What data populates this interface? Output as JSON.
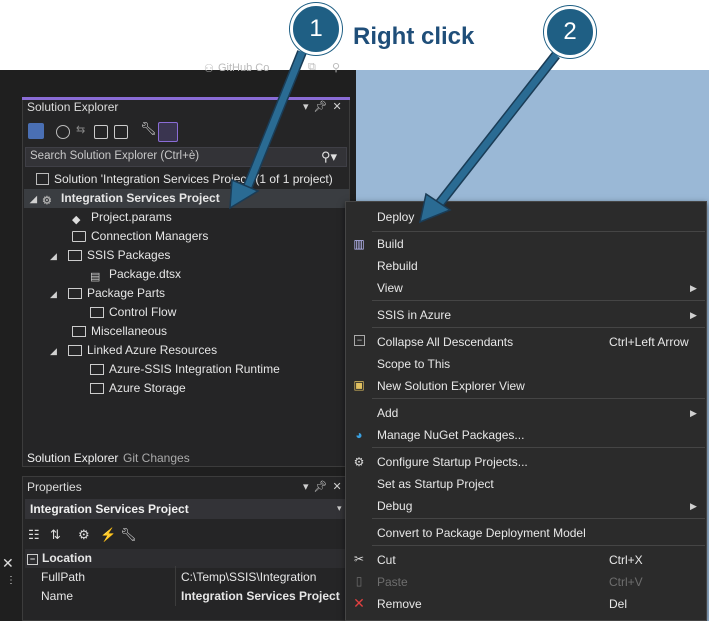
{
  "annotations": {
    "badge1": "1",
    "badge2": "2",
    "right_click_label": "Right click"
  },
  "topbar": {
    "github_label": "GitHub Co"
  },
  "solution_explorer": {
    "title": "Solution Explorer",
    "search_placeholder": "Search Solution Explorer (Ctrl+è)",
    "solution_label": "Solution 'Integration Services Project' (1 of 1 project)",
    "project_label": "Integration Services Project",
    "items": [
      {
        "label": "Project.params",
        "icon": "params-icon"
      },
      {
        "label": "Connection Managers",
        "icon": "folder-icon"
      },
      {
        "label": "SSIS Packages",
        "icon": "folder-icon"
      },
      {
        "label": "Package.dtsx",
        "icon": "package-icon"
      },
      {
        "label": "Package Parts",
        "icon": "folder-icon"
      },
      {
        "label": "Control Flow",
        "icon": "folder-icon"
      },
      {
        "label": "Miscellaneous",
        "icon": "folder-icon"
      },
      {
        "label": "Linked Azure Resources",
        "icon": "folder-icon"
      },
      {
        "label": "Azure-SSIS Integration Runtime",
        "icon": "folder-icon"
      },
      {
        "label": "Azure Storage",
        "icon": "folder-icon"
      }
    ],
    "tabs": [
      "Solution Explorer",
      "Git Changes"
    ]
  },
  "properties": {
    "title": "Properties",
    "object": "Integration Services Project",
    "category": "Location",
    "rows": [
      {
        "name": "FullPath",
        "value": "C:\\Temp\\SSIS\\Integration Service"
      },
      {
        "name": "Name",
        "value": "Integration Services Project"
      }
    ]
  },
  "context_menu": {
    "items": [
      {
        "label": "Deploy",
        "shortcut": ""
      },
      {
        "label": "Build",
        "shortcut": ""
      },
      {
        "label": "Rebuild",
        "shortcut": ""
      },
      {
        "label": "View",
        "shortcut": ""
      },
      {
        "label": "SSIS in Azure",
        "shortcut": ""
      },
      {
        "label": "Collapse All Descendants",
        "shortcut": "Ctrl+Left Arrow"
      },
      {
        "label": "Scope to This",
        "shortcut": ""
      },
      {
        "label": "New Solution Explorer View",
        "shortcut": ""
      },
      {
        "label": "Add",
        "shortcut": ""
      },
      {
        "label": "Manage NuGet Packages...",
        "shortcut": ""
      },
      {
        "label": "Configure Startup Projects...",
        "shortcut": ""
      },
      {
        "label": "Set as Startup Project",
        "shortcut": ""
      },
      {
        "label": "Debug",
        "shortcut": ""
      },
      {
        "label": "Convert to Package Deployment Model",
        "shortcut": ""
      },
      {
        "label": "Cut",
        "shortcut": "Ctrl+X"
      },
      {
        "label": "Paste",
        "shortcut": "Ctrl+V"
      },
      {
        "label": "Remove",
        "shortcut": "Del"
      }
    ]
  },
  "colors": {
    "annotation_blue": "#1f5f84",
    "label_blue": "#1f4e79",
    "ide_dark": "#1f1f1f",
    "accent_purple": "#8a6cd6"
  }
}
